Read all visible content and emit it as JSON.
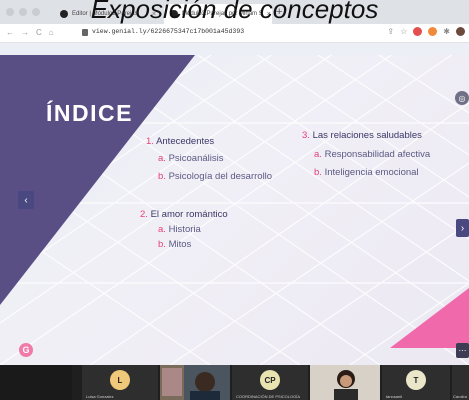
{
  "overlay_title": "Exposición de conceptos",
  "browser": {
    "tabs": [
      {
        "label": "Editor | Módulo3.Parejas"
      },
      {
        "label": "Módulo3.Parejas por Miriam S"
      }
    ],
    "new_tab": "+",
    "tab_close": "×",
    "url": "view.genial.ly/6226675347c17b001a45d393"
  },
  "slide": {
    "title": "ÍNDICE",
    "sections": [
      {
        "num": "1.",
        "label": "Antecedentes",
        "items": [
          {
            "num": "a.",
            "label": "Psicoanálisis"
          },
          {
            "num": "b.",
            "label": "Psicología del desarrollo"
          }
        ]
      },
      {
        "num": "2.",
        "label": "El amor romántico",
        "items": [
          {
            "num": "a.",
            "label": "Historia"
          },
          {
            "num": "b.",
            "label": "Mitos"
          }
        ]
      },
      {
        "num": "3.",
        "label": "Las relaciones saludables",
        "items": [
          {
            "num": "a.",
            "label": "Responsabilidad afectiva"
          },
          {
            "num": "b.",
            "label": "Inteligencia emocional"
          }
        ]
      }
    ],
    "nav_prev": "‹",
    "nav_next": "›",
    "logo": "G",
    "more": "⋯"
  },
  "participants": [
    {
      "initial": "L",
      "name": "Luisa Gonzalez",
      "color": "#f0c87a"
    },
    {
      "initial": "",
      "name": "",
      "color": ""
    },
    {
      "initial": "CP",
      "name": "COORDINACIÓN DE PSICOLOGÍA",
      "color": "#e8e3b0"
    },
    {
      "initial": "",
      "name": "",
      "color": ""
    },
    {
      "initial": "T",
      "name": "tanosanti",
      "color": "#e9e6c9"
    },
    {
      "initial": "",
      "name": "Carolina",
      "color": ""
    }
  ],
  "colors": {
    "accent_pink": "#e8407d",
    "text_dark": "#3a3766",
    "triangle_purple": "#5a4f84",
    "nav_button": "#4a4880"
  }
}
